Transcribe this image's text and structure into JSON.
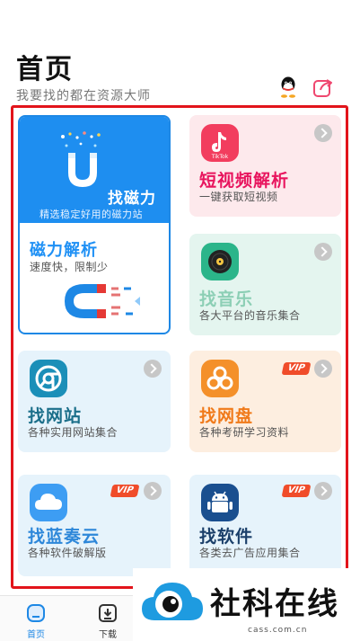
{
  "header": {
    "title": "首页",
    "subtitle": "我要找的都在资源大师",
    "qq_icon": "qq-icon",
    "share_icon": "share-icon"
  },
  "cards": {
    "magnet": {
      "title": "找磁力",
      "subtitle": "精选稳定好用的磁力站",
      "parse_title": "磁力解析",
      "parse_subtitle": "速度快，限制少",
      "accent": "#1e8ef0"
    },
    "short_video": {
      "icon_text": "TikTok",
      "title": "短视频解析",
      "subtitle": "一键获取短视频",
      "accent": "#e8155e"
    },
    "music": {
      "title": "找音乐",
      "subtitle": "各大平台的音乐集合",
      "accent": "#2bb58a"
    },
    "website": {
      "title": "找网站",
      "subtitle": "各种实用网站集合",
      "accent": "#1b8fb8"
    },
    "netdisk": {
      "badge": "VIP",
      "title": "找网盘",
      "subtitle": "各种考研学习资料",
      "accent": "#f07a1a"
    },
    "lanzou": {
      "badge": "VIP",
      "title": "找蓝奏云",
      "subtitle": "各种软件破解版",
      "accent": "#2196f3"
    },
    "software": {
      "badge": "VIP",
      "title": "找软件",
      "subtitle": "各类去广告应用集合",
      "accent": "#1a5fb4"
    }
  },
  "tabbar": {
    "home": "首页",
    "download": "下载"
  },
  "watermark": {
    "text": "社科在线",
    "url": "cass.com.cn"
  }
}
